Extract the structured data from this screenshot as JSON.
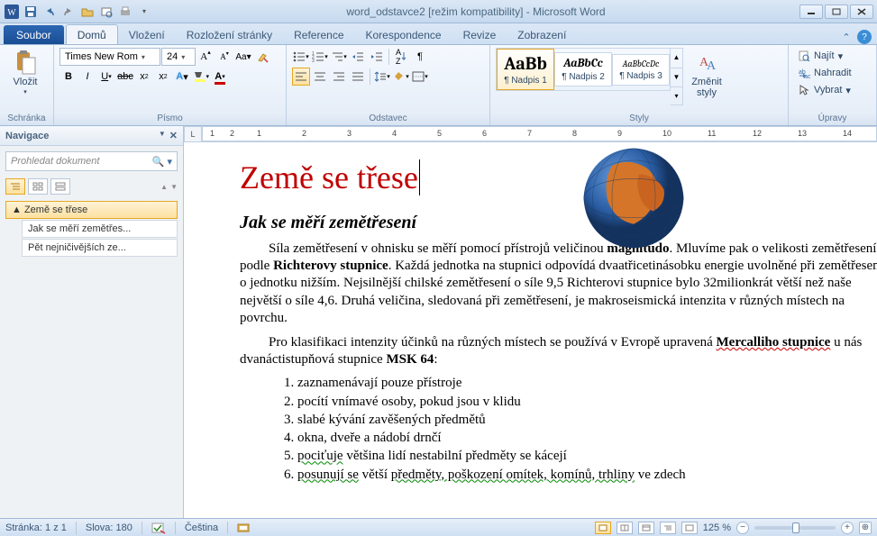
{
  "titlebar": {
    "title": "word_odstavce2 [režim kompatibility] - Microsoft Word"
  },
  "ribbon": {
    "file": "Soubor",
    "tabs": [
      "Domů",
      "Vložení",
      "Rozložení stránky",
      "Reference",
      "Korespondence",
      "Revize",
      "Zobrazení"
    ],
    "active": 0,
    "clipboard": {
      "paste": "Vložit",
      "group": "Schránka"
    },
    "font": {
      "group": "Písmo",
      "name": "Times New Rom",
      "size": "24"
    },
    "paragraph": {
      "group": "Odstavec"
    },
    "styles": {
      "group": "Styly",
      "change": "Změnit\nstyly",
      "items": [
        {
          "preview": "AaBb",
          "name": "¶ Nadpis 1",
          "size": "20px",
          "bold": true,
          "sel": true
        },
        {
          "preview": "AaBbCc",
          "name": "¶ Nadpis 2",
          "size": "13px",
          "bold": true,
          "italic": true,
          "sel": false
        },
        {
          "preview": "AaBbCcDc",
          "name": "¶ Nadpis 3",
          "size": "10px",
          "bold": false,
          "italic": true,
          "sel": false
        }
      ]
    },
    "editing": {
      "group": "Úpravy",
      "find": "Najít",
      "replace": "Nahradit",
      "select": "Vybrat"
    }
  },
  "nav": {
    "title": "Navigace",
    "placeholder": "Prohledat dokument",
    "items": [
      {
        "label": "Země se třese",
        "level": 1,
        "sel": true,
        "tri": "▲"
      },
      {
        "label": "Jak se měří zemětřes...",
        "level": 2,
        "sel": false
      },
      {
        "label": "Pět nejničivějších ze...",
        "level": 2,
        "sel": false
      }
    ]
  },
  "ruler": {
    "corner": "L",
    "marks": [
      "1",
      "2",
      "1",
      "2",
      "3",
      "4",
      "5",
      "6",
      "7",
      "8",
      "9",
      "10",
      "11",
      "12",
      "13",
      "14"
    ]
  },
  "doc": {
    "h1": "Země se třese",
    "h2": "Jak se měří zemětřesení",
    "p1_a": "Síla zemětřesení v ohnisku se měří pomocí přístrojů veličinou ",
    "p1_b": "magnitudo",
    "p1_c": ". Mluvíme pak o velikosti zemětřesení podle ",
    "p1_d": "Richterovy stupnice",
    "p1_e": ". Každá jednotka na stupnici odpovídá dvaatřicetinásobku energie uvolněné při zemětřesení o jednotku nižším. Nejsilnější chilské zemětřesení o síle 9,5 Richterovi stupnice bylo 32milionkrát větší než naše největší o síle 4,6. Druhá veličina, sledovaná při zemětřesení, je makroseismická intenzita v různých místech na povrchu.",
    "p2_a": "Pro klasifikaci intenzity účinků na různých místech se používá v Evropě upravená ",
    "p2_b": "Mercalliho stupnice",
    "p2_c": " u nás dvanáctistupňová stupnice ",
    "p2_d": "MSK 64",
    "p2_e": ":",
    "list": [
      "zaznamenávají pouze přístroje",
      "pocítí vnímavé osoby, pokud jsou v klidu",
      "slabé kývání zavěšených předmětů",
      "okna, dveře a nádobí drnčí",
      "pociťuje většina lidí nestabilní předměty se kácejí",
      "posunují se větší předměty, poškození omítek, komínů, trhliny ve zdech"
    ]
  },
  "status": {
    "page": "Stránka: 1 z 1",
    "words": "Slova: 180",
    "lang": "Čeština",
    "zoom": "125 %"
  }
}
